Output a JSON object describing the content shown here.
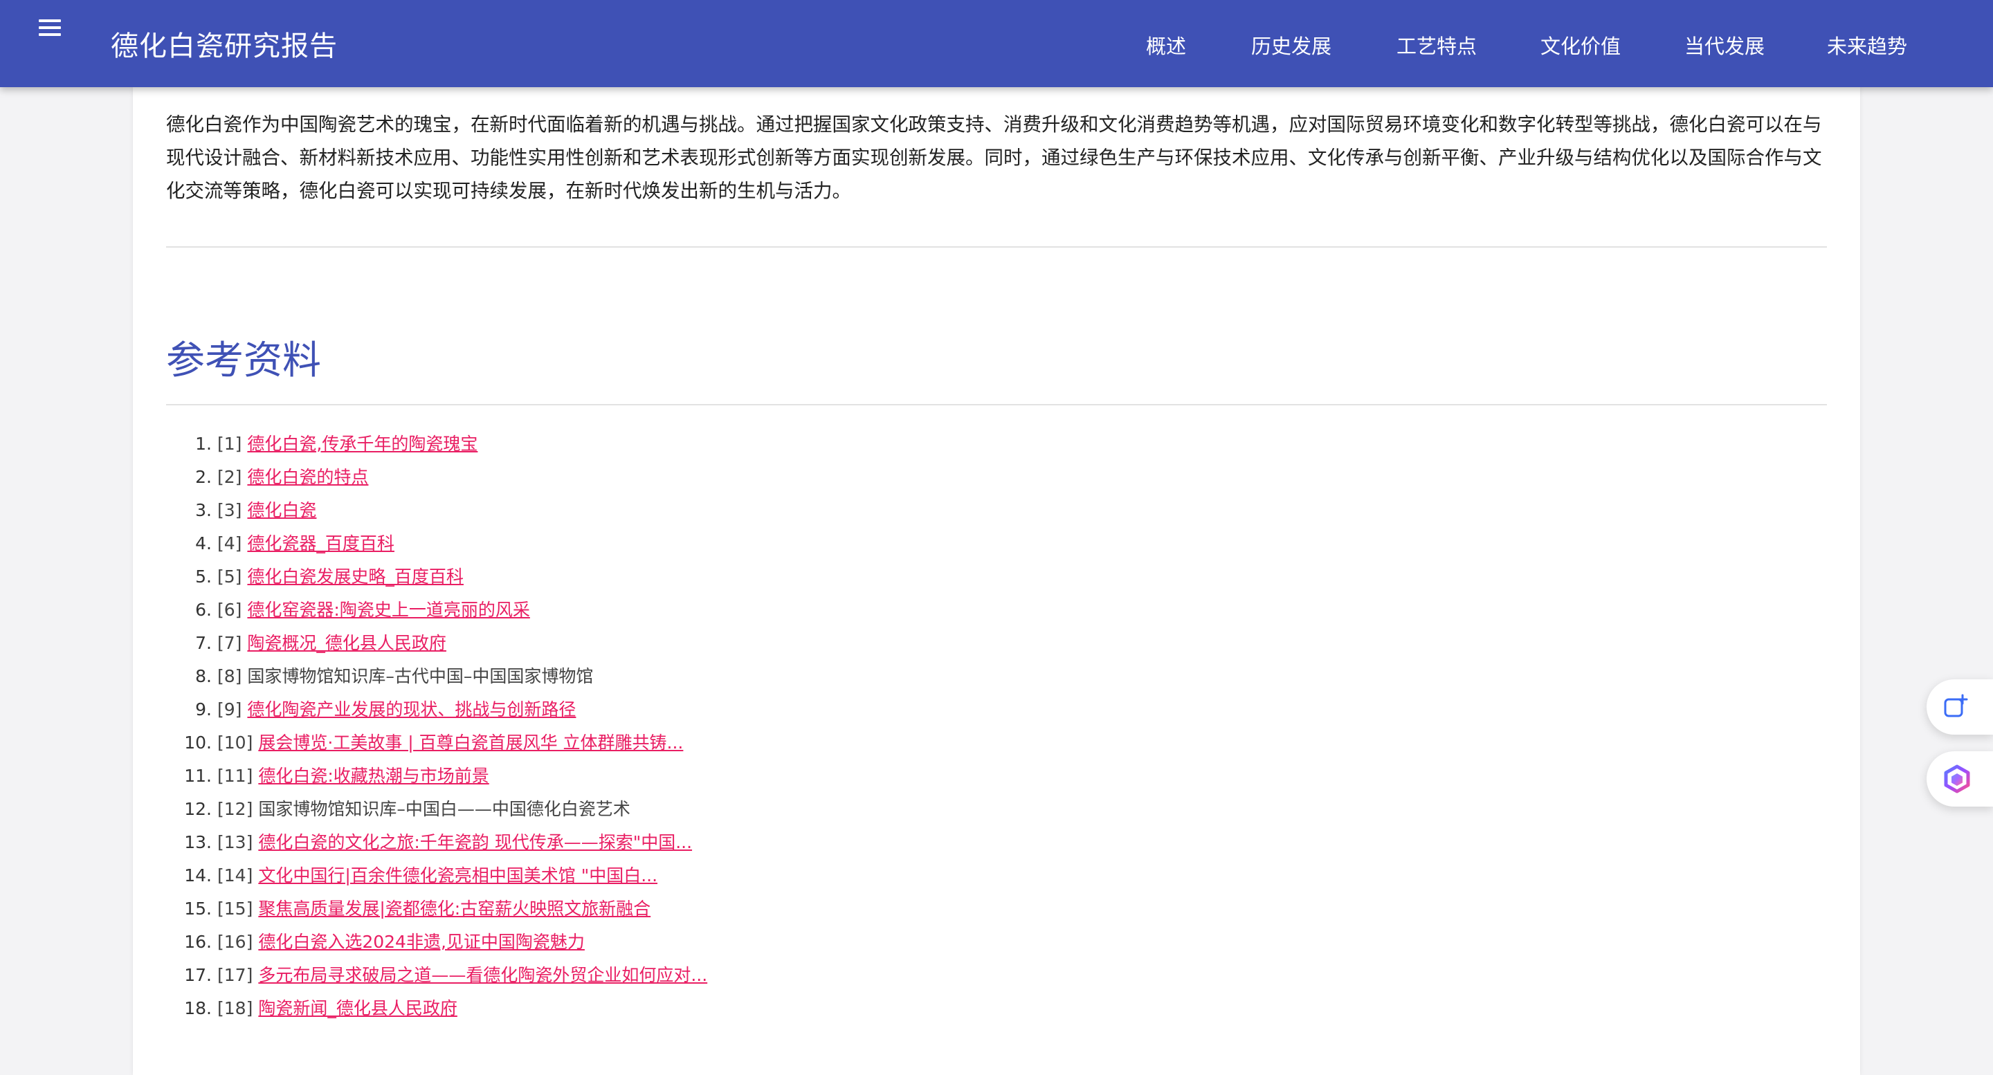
{
  "header": {
    "title": "德化白瓷研究报告",
    "menu_icon": "hamburger-menu-icon",
    "nav": [
      {
        "label": "概述"
      },
      {
        "label": "历史发展"
      },
      {
        "label": "工艺特点"
      },
      {
        "label": "文化价值"
      },
      {
        "label": "当代发展"
      },
      {
        "label": "未来趋势"
      }
    ]
  },
  "main": {
    "summary": "德化白瓷作为中国陶瓷艺术的瑰宝，在新时代面临着新的机遇与挑战。通过把握国家文化政策支持、消费升级和文化消费趋势等机遇，应对国际贸易环境变化和数字化转型等挑战，德化白瓷可以在与现代设计融合、新材料新技术应用、功能性实用性创新和艺术表现形式创新等方面实现创新发展。同时，通过绿色生产与环保技术应用、文化传承与创新平衡、产业升级与结构优化以及国际合作与文化交流等策略，德化白瓷可以实现可持续发展，在新时代焕发出新的生机与活力。",
    "references_heading": "参考资料",
    "references": [
      {
        "num": "1.",
        "tag": "[1]",
        "text": "德化白瓷,传承千年的陶瓷瑰宝",
        "link": true
      },
      {
        "num": "2.",
        "tag": "[2]",
        "text": "德化白瓷的特点",
        "link": true
      },
      {
        "num": "3.",
        "tag": "[3]",
        "text": "德化白瓷",
        "link": true
      },
      {
        "num": "4.",
        "tag": "[4]",
        "text": "德化瓷器_百度百科",
        "link": true
      },
      {
        "num": "5.",
        "tag": "[5]",
        "text": "德化白瓷发展史略_百度百科",
        "link": true
      },
      {
        "num": "6.",
        "tag": "[6]",
        "text": "德化窑瓷器:陶瓷史上一道亮丽的风采",
        "link": true
      },
      {
        "num": "7.",
        "tag": "[7]",
        "text": "陶瓷概况_德化县人民政府",
        "link": true
      },
      {
        "num": "8.",
        "tag": "[8]",
        "text": "国家博物馆知识库–古代中国–中国国家博物馆",
        "link": false
      },
      {
        "num": "9.",
        "tag": "[9]",
        "text": "德化陶瓷产业发展的现状、挑战与创新路径",
        "link": true
      },
      {
        "num": "10.",
        "tag": "[10]",
        "text": "展会博览·工美故事 | 百尊白瓷首展风华 立体群雕共铸...",
        "link": true
      },
      {
        "num": "11.",
        "tag": "[11]",
        "text": "德化白瓷:收藏热潮与市场前景",
        "link": true
      },
      {
        "num": "12.",
        "tag": "[12]",
        "text": "国家博物馆知识库–中国白——中国德化白瓷艺术",
        "link": false
      },
      {
        "num": "13.",
        "tag": "[13]",
        "text": "德化白瓷的文化之旅:千年瓷韵 现代传承——探索\"中国...",
        "link": true
      },
      {
        "num": "14.",
        "tag": "[14]",
        "text": "文化中国行|百余件德化瓷亮相中国美术馆 \"中国白...",
        "link": true
      },
      {
        "num": "15.",
        "tag": "[15]",
        "text": "聚焦高质量发展|瓷都德化:古窑薪火映照文旅新融合",
        "link": true
      },
      {
        "num": "16.",
        "tag": "[16]",
        "text": "德化白瓷入选2024非遗,见证中国陶瓷魅力",
        "link": true
      },
      {
        "num": "17.",
        "tag": "[17]",
        "text": "多元布局寻求破局之道——看德化陶瓷外贸企业如何应对...",
        "link": true
      },
      {
        "num": "18.",
        "tag": "[18]",
        "text": "陶瓷新闻_德化县人民政府",
        "link": true
      }
    ]
  },
  "floating": {
    "new_chat_icon": "new-chat-icon",
    "assistant_icon": "assistant-logo-icon"
  },
  "colors": {
    "appbar": "#3f51b5",
    "heading": "#3f51b5",
    "link": "#e91e63"
  }
}
